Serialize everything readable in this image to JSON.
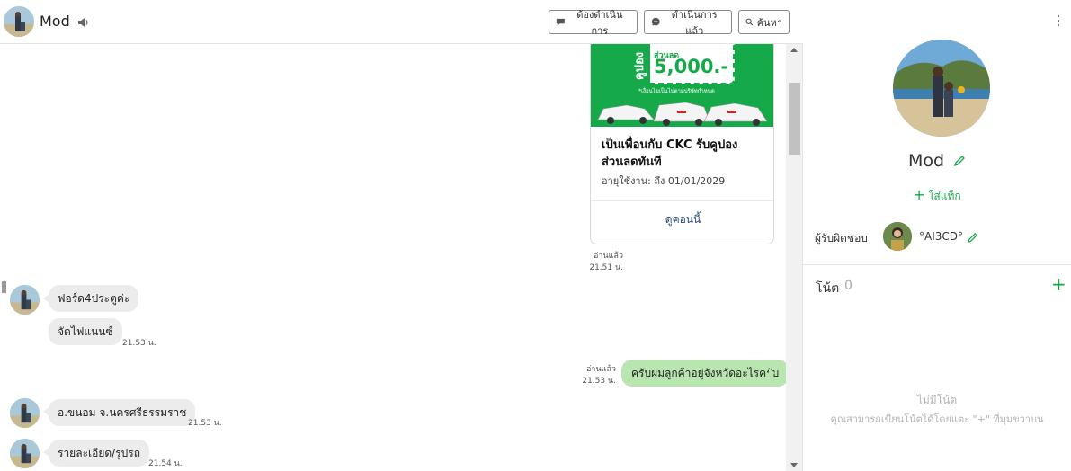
{
  "header": {
    "contact_name": "Mod",
    "buttons": {
      "todo": "ต้องดำเนินการ",
      "done": "ดำเนินการแล้ว",
      "search": "ค้นหา"
    }
  },
  "messages": {
    "coupon_card": {
      "image_vertical_text": "คูปอง",
      "image_small_text": "ส่วนลด",
      "image_amount": "5,000.-",
      "image_note": "*เงื่อนไขเป็นไปตามบริษัทกำหนด",
      "title": "เป็นเพื่อนกับ CKC รับคูปองส่วนลดทันที",
      "expiry": "อายุใช้งาน: ถึง 01/01/2029",
      "link": "ดูคอนนี้"
    },
    "card_read": "อ่านแล้ว",
    "card_time": "21.51 น.",
    "in1_text": "ฟอร์ด4ประตูค่ะ",
    "in2_text": "จัดไฟแนนซ์",
    "in2_time": "21.53 น.",
    "out1_read": "อ่านแล้ว",
    "out1_time": "21.53 น.",
    "out1_text": "ครับผมลูกค้าอยู่จังหวัดอะไรครับ",
    "in3_text": "อ.ขนอม จ.นครศรีธรรมราช",
    "in3_time": "21.53 น.",
    "in4_text": "รายละเอียด/รูปรถ",
    "in4_time": "21.54 น."
  },
  "panel": {
    "name": "Mod",
    "add_tag": "ใส่แท็ก",
    "assignee_label": "ผู้รับผิดชอบ",
    "assignee_name": "°AI3CD°",
    "notes_title": "โน้ต",
    "notes_count": "0",
    "add_note": "+",
    "empty_title": "ไม่มีโน้ต",
    "empty_sub": "คุณสามารถเขียนโน้ตได้โดยแตะ \"+\" ที่มุมขวาบน"
  },
  "colors": {
    "accent_green": "#16a94a",
    "outgoing_bubble": "#b9e6b0",
    "incoming_bubble": "#ececec"
  },
  "icons": {
    "speaker": "speaker-icon",
    "todo": "chat-bubble-icon",
    "done": "chat-check-icon",
    "search": "search-icon",
    "edit": "pencil-icon",
    "more": "kebab-icon"
  }
}
